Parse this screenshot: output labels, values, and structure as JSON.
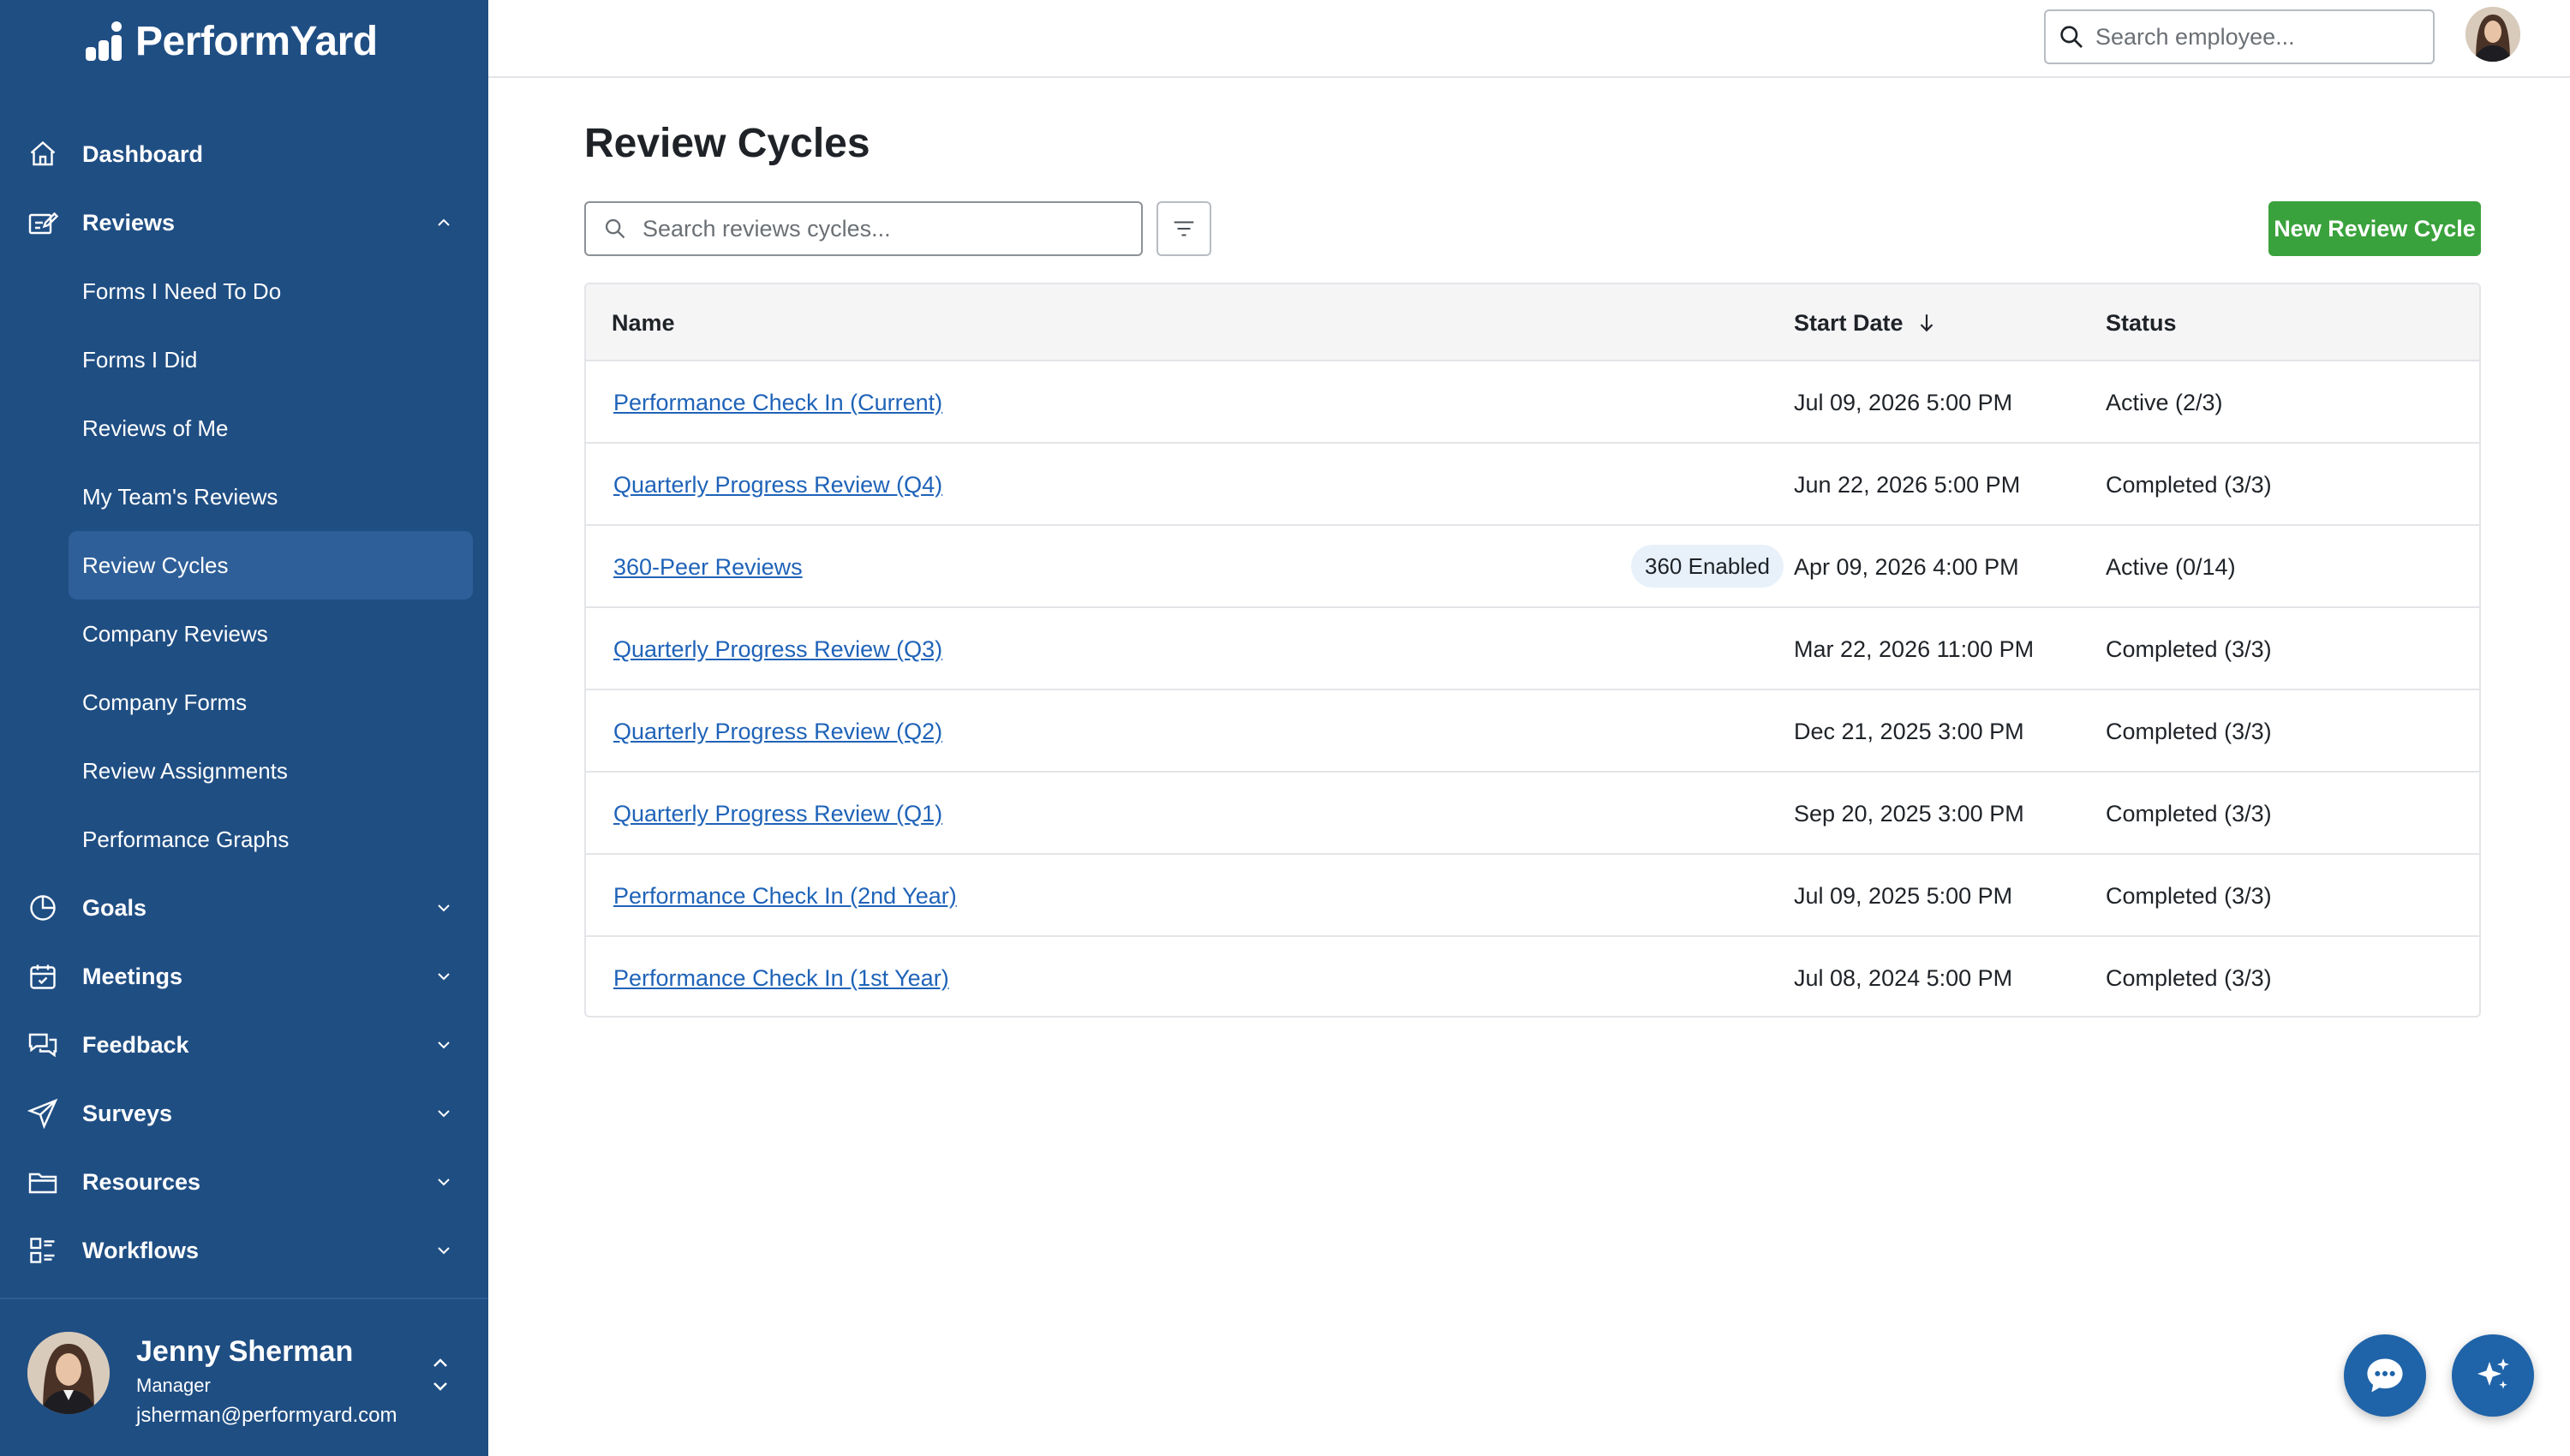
{
  "brand": {
    "name": "PerformYard"
  },
  "sidebar": {
    "items": [
      {
        "label": "Dashboard",
        "icon": "home-icon"
      },
      {
        "label": "Reviews",
        "icon": "reviews-icon",
        "expanded": true,
        "children": [
          {
            "label": "Forms I Need To Do"
          },
          {
            "label": "Forms I Did"
          },
          {
            "label": "Reviews of Me"
          },
          {
            "label": "My Team's Reviews"
          },
          {
            "label": "Review Cycles",
            "active": true
          },
          {
            "label": "Company Reviews"
          },
          {
            "label": "Company Forms"
          },
          {
            "label": "Review Assignments"
          },
          {
            "label": "Performance Graphs"
          }
        ]
      },
      {
        "label": "Goals",
        "icon": "goals-icon"
      },
      {
        "label": "Meetings",
        "icon": "calendar-icon"
      },
      {
        "label": "Feedback",
        "icon": "chat-bubbles-icon"
      },
      {
        "label": "Surveys",
        "icon": "paper-plane-icon"
      },
      {
        "label": "Resources",
        "icon": "folder-icon"
      },
      {
        "label": "Workflows",
        "icon": "workflows-icon"
      }
    ],
    "user": {
      "name": "Jenny Sherman",
      "role": "Manager",
      "email": "jsherman@performyard.com"
    }
  },
  "topbar": {
    "search_placeholder": "Search employee..."
  },
  "main": {
    "title": "Review Cycles",
    "search_placeholder": "Search reviews cycles...",
    "new_button": "New Review Cycle",
    "table": {
      "headers": {
        "name": "Name",
        "start_date": "Start Date",
        "status": "Status"
      },
      "rows": [
        {
          "name": "Performance Check In (Current)",
          "start_date": "Jul 09, 2026 5:00 PM",
          "status": "Active (2/3)"
        },
        {
          "name": "Quarterly Progress Review (Q4)",
          "start_date": "Jun 22, 2026 5:00 PM",
          "status": "Completed (3/3)"
        },
        {
          "name": "360-Peer Reviews",
          "badge": "360 Enabled",
          "start_date": "Apr 09, 2026 4:00 PM",
          "status": "Active (0/14)"
        },
        {
          "name": "Quarterly Progress Review (Q3)",
          "start_date": "Mar 22, 2026 11:00 PM",
          "status": "Completed (3/3)"
        },
        {
          "name": "Quarterly Progress Review (Q2)",
          "start_date": "Dec 21, 2025 3:00 PM",
          "status": "Completed (3/3)"
        },
        {
          "name": "Quarterly Progress Review (Q1)",
          "start_date": "Sep 20, 2025 3:00 PM",
          "status": "Completed (3/3)"
        },
        {
          "name": "Performance Check In (2nd Year)",
          "start_date": "Jul 09, 2025 5:00 PM",
          "status": "Completed (3/3)"
        },
        {
          "name": "Performance Check In (1st Year)",
          "start_date": "Jul 08, 2024 5:00 PM",
          "status": "Completed (3/3)"
        }
      ]
    }
  },
  "colors": {
    "sidebar": "#1f4e83",
    "active_item": "#2e5f98",
    "primary_button": "#3aa23c",
    "link": "#1f63b8",
    "fab": "#1f63a8"
  },
  "floating_buttons": [
    {
      "icon": "chat-icon"
    },
    {
      "icon": "sparkle-icon"
    }
  ]
}
